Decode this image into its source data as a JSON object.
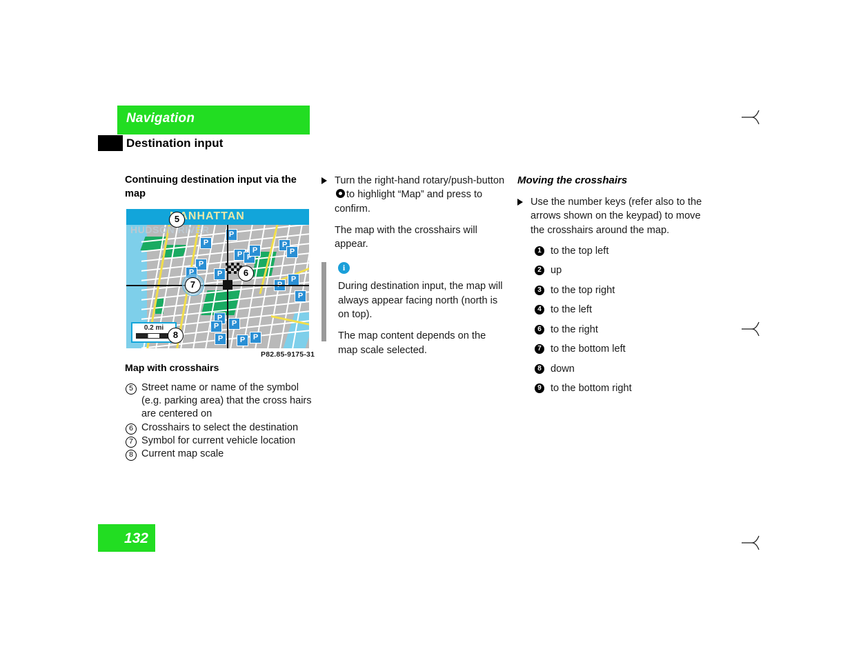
{
  "header": {
    "section_title": "Navigation",
    "sub_title": "Destination input",
    "green": "#22dd22"
  },
  "left_column": {
    "subhead": "Continuing destination input via the map",
    "figure_code": "P82.85-9175-31",
    "figure_caption": "Map with crosshairs",
    "map": {
      "banner_label": "MANHATTAN",
      "river_label": "HUDSON RIVER",
      "scale_label": "0.2 mi",
      "parking_letter": "P",
      "callouts": [
        "5",
        "6",
        "7",
        "8"
      ]
    },
    "legend": [
      {
        "num": "5",
        "text": "Street name or name of the symbol (e.g. parking area) that the cross hairs are centered on"
      },
      {
        "num": "6",
        "text": "Crosshairs to select the destination"
      },
      {
        "num": "7",
        "text": "Symbol for current vehicle location"
      },
      {
        "num": "8",
        "text": "Current map scale"
      }
    ]
  },
  "middle_column": {
    "step_1_part_a": "Turn the right-hand rotary/push-button",
    "step_1_part_b": "to highlight “Map” and press to confirm.",
    "result": "The map with the crosshairs will appear.",
    "note": {
      "icon": "info-icon",
      "paragraph_1": "During destination input, the map will always appear facing north (north is on top).",
      "paragraph_2": "The map content depends on the map scale selected."
    }
  },
  "right_column": {
    "subhead": "Moving the crosshairs",
    "step": "Use the number keys (refer also to the arrows shown on the keypad) to move the crosshairs around the map.",
    "keys": [
      {
        "num": "1",
        "label": "to the top left"
      },
      {
        "num": "2",
        "label": "up"
      },
      {
        "num": "3",
        "label": "to the top right"
      },
      {
        "num": "4",
        "label": "to the left"
      },
      {
        "num": "6",
        "label": "to the right"
      },
      {
        "num": "7",
        "label": "to the bottom left"
      },
      {
        "num": "8",
        "label": "down"
      },
      {
        "num": "9",
        "label": "to the bottom right"
      }
    ]
  },
  "footer": {
    "page_number": "132"
  },
  "cut_marks": [
    "scissors-icon",
    "scissors-icon",
    "scissors-icon"
  ]
}
